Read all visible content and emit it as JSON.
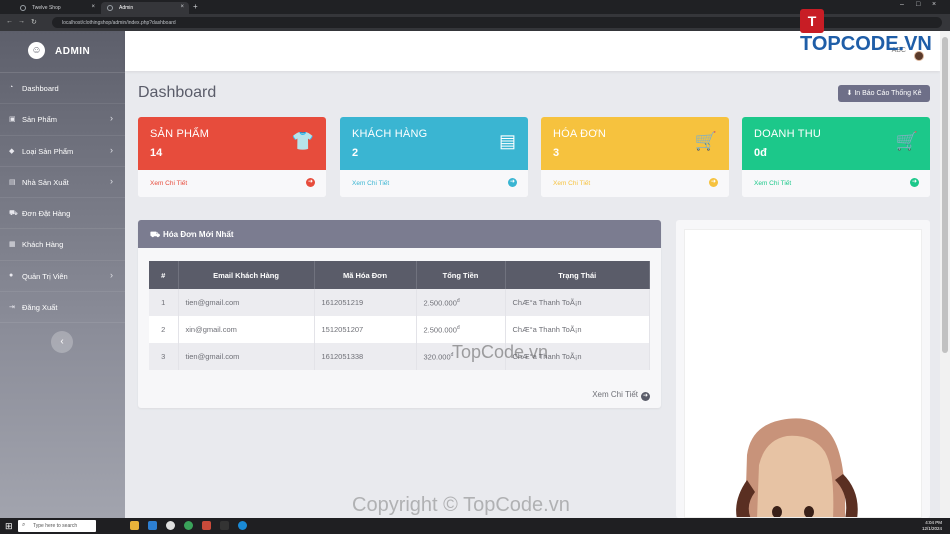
{
  "browser": {
    "tabs": [
      {
        "label": "Twelve Shop",
        "active": false
      },
      {
        "label": "Admin",
        "active": true
      }
    ],
    "url": "localhost/clothingshop/admin/index.php?dashboard"
  },
  "brand": {
    "name": "ADMIN"
  },
  "sidebar": {
    "items": [
      {
        "label": "Dashboard",
        "icon": "dashboard-icon",
        "has_sub": false
      },
      {
        "label": "Sản Phẩm",
        "icon": "box-icon",
        "has_sub": true
      },
      {
        "label": "Loại Sản Phẩm",
        "icon": "tag-icon",
        "has_sub": true
      },
      {
        "label": "Nhà Sản Xuất",
        "icon": "factory-icon",
        "has_sub": true
      },
      {
        "label": "Đơn Đặt Hàng",
        "icon": "cart-icon",
        "has_sub": false
      },
      {
        "label": "Khách Hàng",
        "icon": "address-book-icon",
        "has_sub": false
      },
      {
        "label": "Quản Trị Viên",
        "icon": "users-icon",
        "has_sub": true
      },
      {
        "label": "Đăng Xuất",
        "icon": "logout-icon",
        "has_sub": false
      }
    ],
    "collapse_glyph": "‹"
  },
  "topbar": {
    "user": "ABC"
  },
  "page": {
    "title": "Dashboard",
    "report_button": "In Báo Cáo Thống Kê"
  },
  "cards": [
    {
      "title": "SẢN PHẨM",
      "value": "14",
      "icon": "shirt-icon",
      "link": "Xem Chi Tiết",
      "color": "#e74c3c"
    },
    {
      "title": "KHÁCH HÀNG",
      "value": "2",
      "icon": "address-book-icon",
      "link": "Xem Chi Tiết",
      "color": "#3ab5d2"
    },
    {
      "title": "HÓA ĐƠN",
      "value": "3",
      "icon": "cart-icon",
      "link": "Xem Chi Tiết",
      "color": "#f6c23e"
    },
    {
      "title": "DOANH THU",
      "value": "0đ",
      "icon": "cart-icon",
      "link": "Xem Chi Tiết",
      "color": "#1cc88a"
    }
  ],
  "orders_panel": {
    "title": "Hóa Đơn Mới Nhất",
    "columns": [
      "#",
      "Email Khách Hàng",
      "Mã Hóa Đơn",
      "Tổng Tiền",
      "Trạng Thái"
    ],
    "rows": [
      {
        "no": "1",
        "email": "tien@gmail.com",
        "code": "1612051219",
        "total": "2.500.000",
        "currency": "đ",
        "status": "ChÆ°a Thanh ToÃ¡n"
      },
      {
        "no": "2",
        "email": "xin@gmail.com",
        "code": "1512051207",
        "total": "2.500.000",
        "currency": "đ",
        "status": "ChÆ°a Thanh ToÃ¡n"
      },
      {
        "no": "3",
        "email": "tien@gmail.com",
        "code": "1612051338",
        "total": "320.000",
        "currency": "đ",
        "status": "ChÆ°a Thanh ToÃ¡n"
      }
    ],
    "more_link": "Xem Chi Tiết"
  },
  "taskbar": {
    "search_placeholder": "Type here to search",
    "time": "4:04 PM",
    "date": "12/1/2024"
  },
  "watermarks": {
    "logo": "TOPCODE.VN",
    "center": "TopCode.vn",
    "footer": "Copyright © TopCode.vn"
  }
}
